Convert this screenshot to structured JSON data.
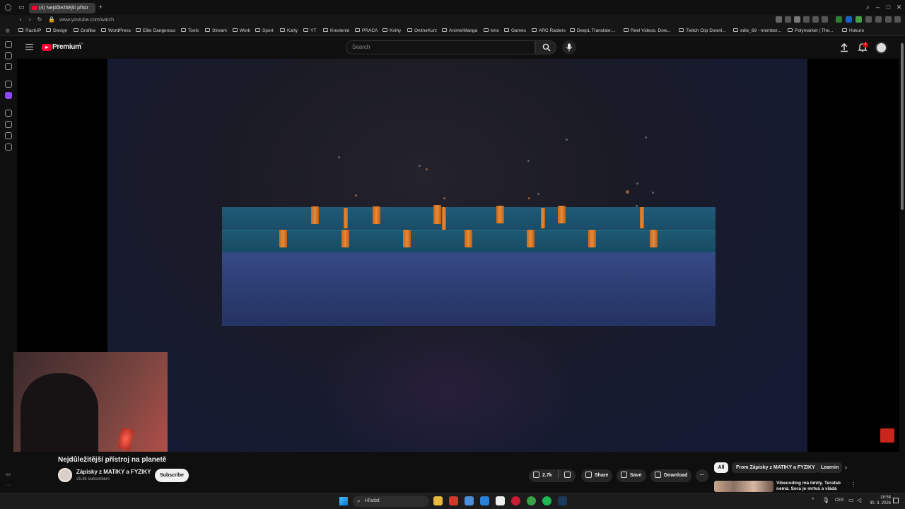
{
  "browser": {
    "tab_title": "(4) Nejdůležitější přístr",
    "url": "www.youtube.com/watch",
    "bookmarks": [
      "RastUP",
      "Design",
      "Grafika",
      "WordPress",
      "Elite Dangerous",
      "Tools",
      "Stream",
      "Work",
      "Sport",
      "Karty",
      "YT",
      "Kreslenie",
      "PRACA",
      "Knihy",
      "OnlineKurz",
      "Anime/Manga",
      "kmx",
      "Games",
      "ARC Raiders",
      "DeepL Translate:...",
      "Reel Videos, Dow...",
      "Twitch Clip Downl...",
      "edie_69 - member...",
      "Polymarket | The...",
      "Hokuro"
    ]
  },
  "youtube": {
    "logo_text": "Premium",
    "country_code": "CK",
    "search_placeholder": "Search",
    "notification_count": "4"
  },
  "video": {
    "title": "Nejdůležitější přístroj na planetě",
    "channel_name": "Zápisky z MATIKY a FYZIKY",
    "subscribers": "25.8k subscribers",
    "subscribe_label": "Subscribe",
    "likes": "2.7k",
    "share_label": "Share",
    "save_label": "Save",
    "download_label": "Download"
  },
  "sidebar_panel": {
    "chips": [
      "All",
      "From Zápisky z MATIKY a FYZIKY",
      "Learnin"
    ],
    "recommended_title": "Vibecoding má limity. Terafab nemá. Sora je mrtvá a vládá"
  },
  "taskbar": {
    "search_placeholder": "Hľadať",
    "lang": "CES",
    "time": "18:58",
    "date": "30. 3. 2026"
  },
  "colors": {
    "accent_red": "#ff0033",
    "background": "#0f0f0f"
  }
}
